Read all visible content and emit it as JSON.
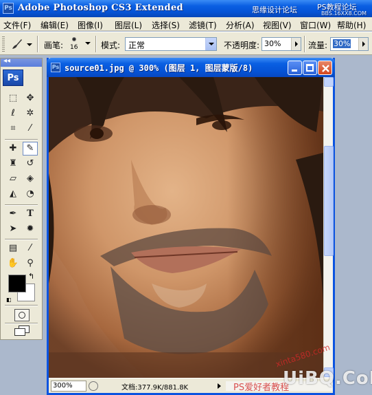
{
  "app": {
    "logo": "Ps",
    "title": "Adobe Photoshop CS3 Extended",
    "watermark_left": "思缘设计论坛",
    "watermark_right": "PS教程论坛",
    "watermark_url": "BBS.16XX8.COM"
  },
  "menubar": {
    "items": [
      {
        "label": "文件(F)"
      },
      {
        "label": "编辑(E)"
      },
      {
        "label": "图像(I)"
      },
      {
        "label": "图层(L)"
      },
      {
        "label": "选择(S)"
      },
      {
        "label": "滤镜(T)"
      },
      {
        "label": "分析(A)"
      },
      {
        "label": "视图(V)"
      },
      {
        "label": "窗口(W)"
      },
      {
        "label": "帮助(H)"
      }
    ]
  },
  "options": {
    "brush_label": "画笔:",
    "brush_size": "16",
    "mode_label": "模式:",
    "mode_value": "正常",
    "opacity_label": "不透明度:",
    "opacity_value": "30%",
    "flow_label": "流量:",
    "flow_value": "30%"
  },
  "toolbox": {
    "header": "◂◂",
    "logo": "Ps"
  },
  "document": {
    "title": "source01.jpg @ 300% (图层 1, 图层蒙版/8)",
    "icon": "Ps",
    "zoom": "300%",
    "doc_info": "文档:377.9K/881.8K"
  },
  "watermarks": {
    "site": "UiBQ.CoM",
    "red_small": "xinta580.com",
    "red_bottom": "PS爱好者教程"
  }
}
